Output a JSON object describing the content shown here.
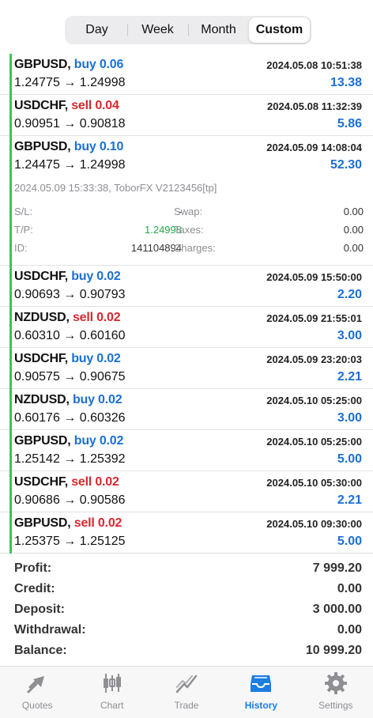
{
  "period_tabs": [
    {
      "label": "Day",
      "active": false
    },
    {
      "label": "Week",
      "active": false
    },
    {
      "label": "Month",
      "active": false
    },
    {
      "label": "Custom",
      "active": true
    }
  ],
  "deals": [
    {
      "symbol": "GBPUSD,",
      "side": "buy",
      "volume": "buy 0.06",
      "time": "2024.05.08 10:51:38",
      "prices": "1.24775 → 1.24998",
      "profit": "13.38"
    },
    {
      "symbol": "USDCHF,",
      "side": "sell",
      "volume": "sell 0.04",
      "time": "2024.05.08 11:32:39",
      "prices": "0.90951 → 0.90818",
      "profit": "5.86"
    },
    {
      "symbol": "USDCHF,",
      "side": "buy",
      "volume": "buy 0.02",
      "time": "2024.05.09 15:50:00",
      "prices": "0.90693 → 0.90793",
      "profit": "2.20"
    },
    {
      "symbol": "NZDUSD,",
      "side": "sell",
      "volume": "sell 0.02",
      "time": "2024.05.09 21:55:01",
      "prices": "0.60310 → 0.60160",
      "profit": "3.00"
    },
    {
      "symbol": "USDCHF,",
      "side": "buy",
      "volume": "buy 0.02",
      "time": "2024.05.09 23:20:03",
      "prices": "0.90575 → 0.90675",
      "profit": "2.21"
    },
    {
      "symbol": "NZDUSD,",
      "side": "buy",
      "volume": "buy 0.02",
      "time": "2024.05.10 05:25:00",
      "prices": "0.60176 → 0.60326",
      "profit": "3.00"
    },
    {
      "symbol": "GBPUSD,",
      "side": "buy",
      "volume": "buy 0.02",
      "time": "2024.05.10 05:25:00",
      "prices": "1.25142 → 1.25392",
      "profit": "5.00"
    },
    {
      "symbol": "USDCHF,",
      "side": "sell",
      "volume": "sell 0.02",
      "time": "2024.05.10 05:30:00",
      "prices": "0.90686 → 0.90586",
      "profit": "2.21"
    },
    {
      "symbol": "GBPUSD,",
      "side": "sell",
      "volume": "sell 0.02",
      "time": "2024.05.10 09:30:00",
      "prices": "1.25375 → 1.25125",
      "profit": "5.00"
    }
  ],
  "expanded_deal": {
    "symbol": "GBPUSD,",
    "side": "buy",
    "volume": "buy 0.10",
    "time": "2024.05.09 14:08:04",
    "prices": "1.24475 → 1.24998",
    "profit": "52.30",
    "comment": "2024.05.09 15:33:38, ToborFX V2123456[tp]",
    "sl_label": "S/L:",
    "sl_value": "-",
    "tp_label": "T/P:",
    "tp_value": "1.24998",
    "id_label": "ID:",
    "id_value": "141104894",
    "swap_label": "Swap:",
    "swap_value": "0.00",
    "taxes_label": "Taxes:",
    "taxes_value": "0.00",
    "charges_label": "Charges:",
    "charges_value": "0.00"
  },
  "summary": [
    {
      "label": "Profit:",
      "value": "7 999.20"
    },
    {
      "label": "Credit:",
      "value": "0.00"
    },
    {
      "label": "Deposit:",
      "value": "3 000.00"
    },
    {
      "label": "Withdrawal:",
      "value": "0.00"
    },
    {
      "label": "Balance:",
      "value": "10 999.20"
    }
  ],
  "tabbar": [
    {
      "label": "Quotes",
      "icon": "quotes-icon",
      "active": false
    },
    {
      "label": "Chart",
      "icon": "candlestick-chart-icon",
      "active": false
    },
    {
      "label": "Trade",
      "icon": "trade-icon",
      "active": false
    },
    {
      "label": "History",
      "icon": "inbox-tray-icon",
      "active": true
    },
    {
      "label": "Settings",
      "icon": "gear-icon",
      "active": false
    }
  ],
  "colors": {
    "buy": "#1b6fd6",
    "sell": "#d9282f",
    "accent": "#1b7ee3",
    "deal_bar": "#34c759",
    "tp_green": "#2aa54a"
  }
}
